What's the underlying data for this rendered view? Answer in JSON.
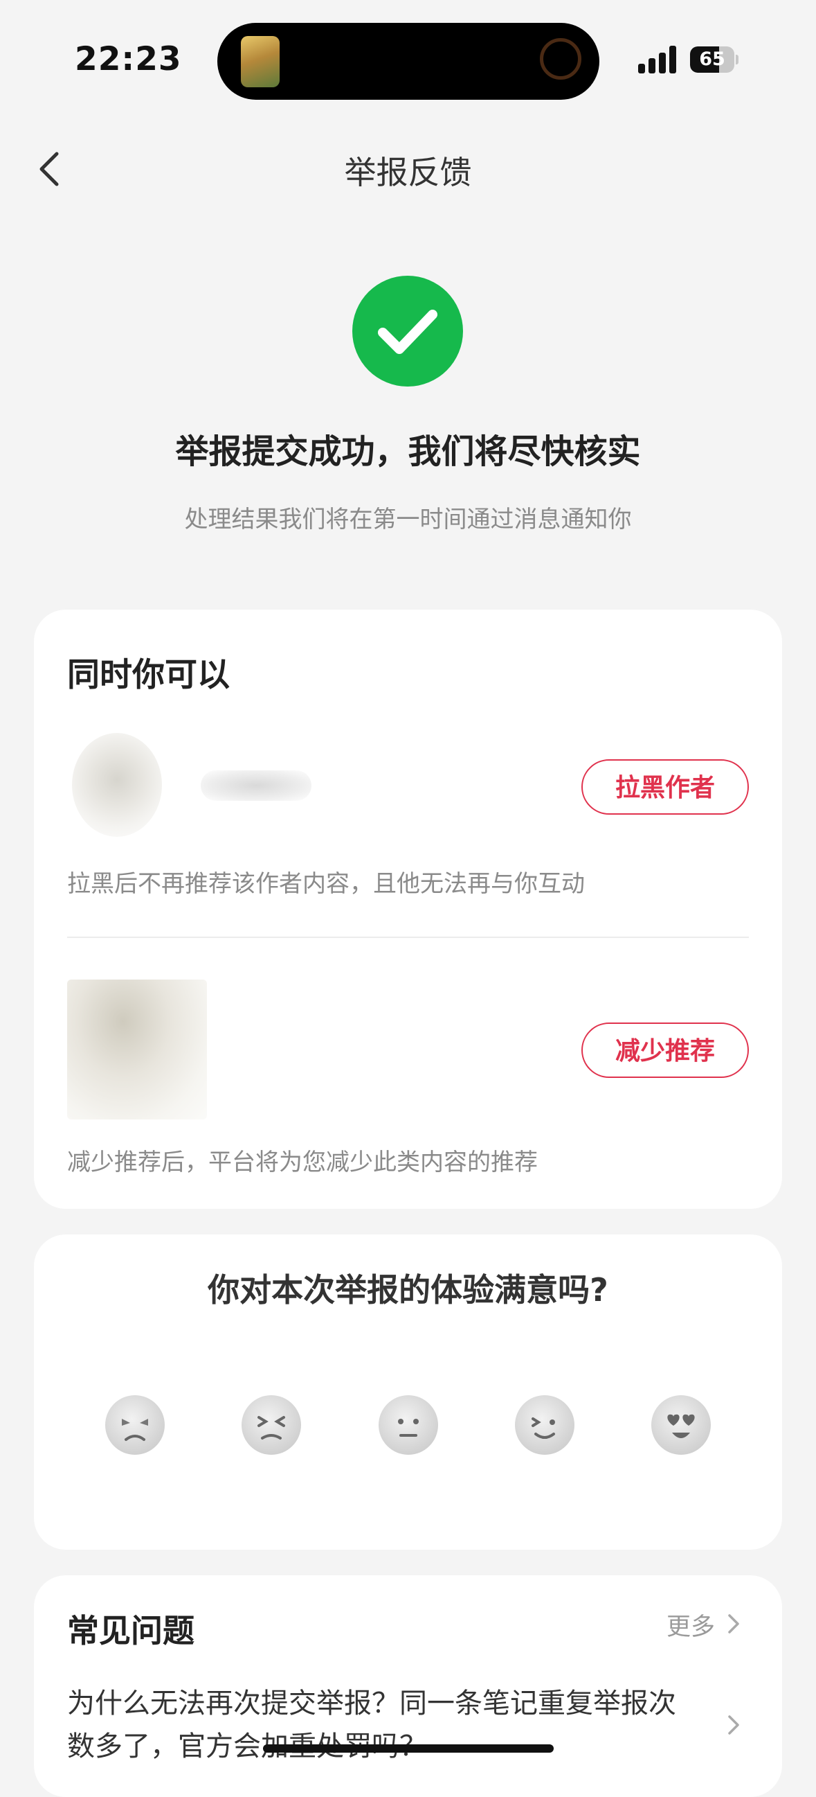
{
  "status_bar": {
    "time": "22:23",
    "battery": "65",
    "battery_level": 0.65
  },
  "nav": {
    "title": "举报反馈"
  },
  "success": {
    "title": "举报提交成功，我们将尽快核实",
    "subtitle": "处理结果我们将在第一时间通过消息通知你"
  },
  "actions": {
    "heading": "同时你可以",
    "block_author": {
      "button": "拉黑作者",
      "description": "拉黑后不再推荐该作者内容，且他无法再与你互动"
    },
    "reduce_recommend": {
      "button": "减少推荐",
      "description": "减少推荐后，平台将为您减少此类内容的推荐"
    }
  },
  "rating": {
    "question": "你对本次举报的体验满意吗?",
    "options": [
      "very-unsatisfied",
      "unsatisfied",
      "neutral",
      "satisfied",
      "very-satisfied"
    ]
  },
  "faq": {
    "title": "常见问题",
    "more": "更多",
    "question": "为什么无法再次提交举报？同一条笔记重复举报次数多了，官方会加重处罚吗？"
  },
  "colors": {
    "accent_red": "#e0324d",
    "success_green": "#16b94c",
    "background": "#f4f4f4"
  }
}
